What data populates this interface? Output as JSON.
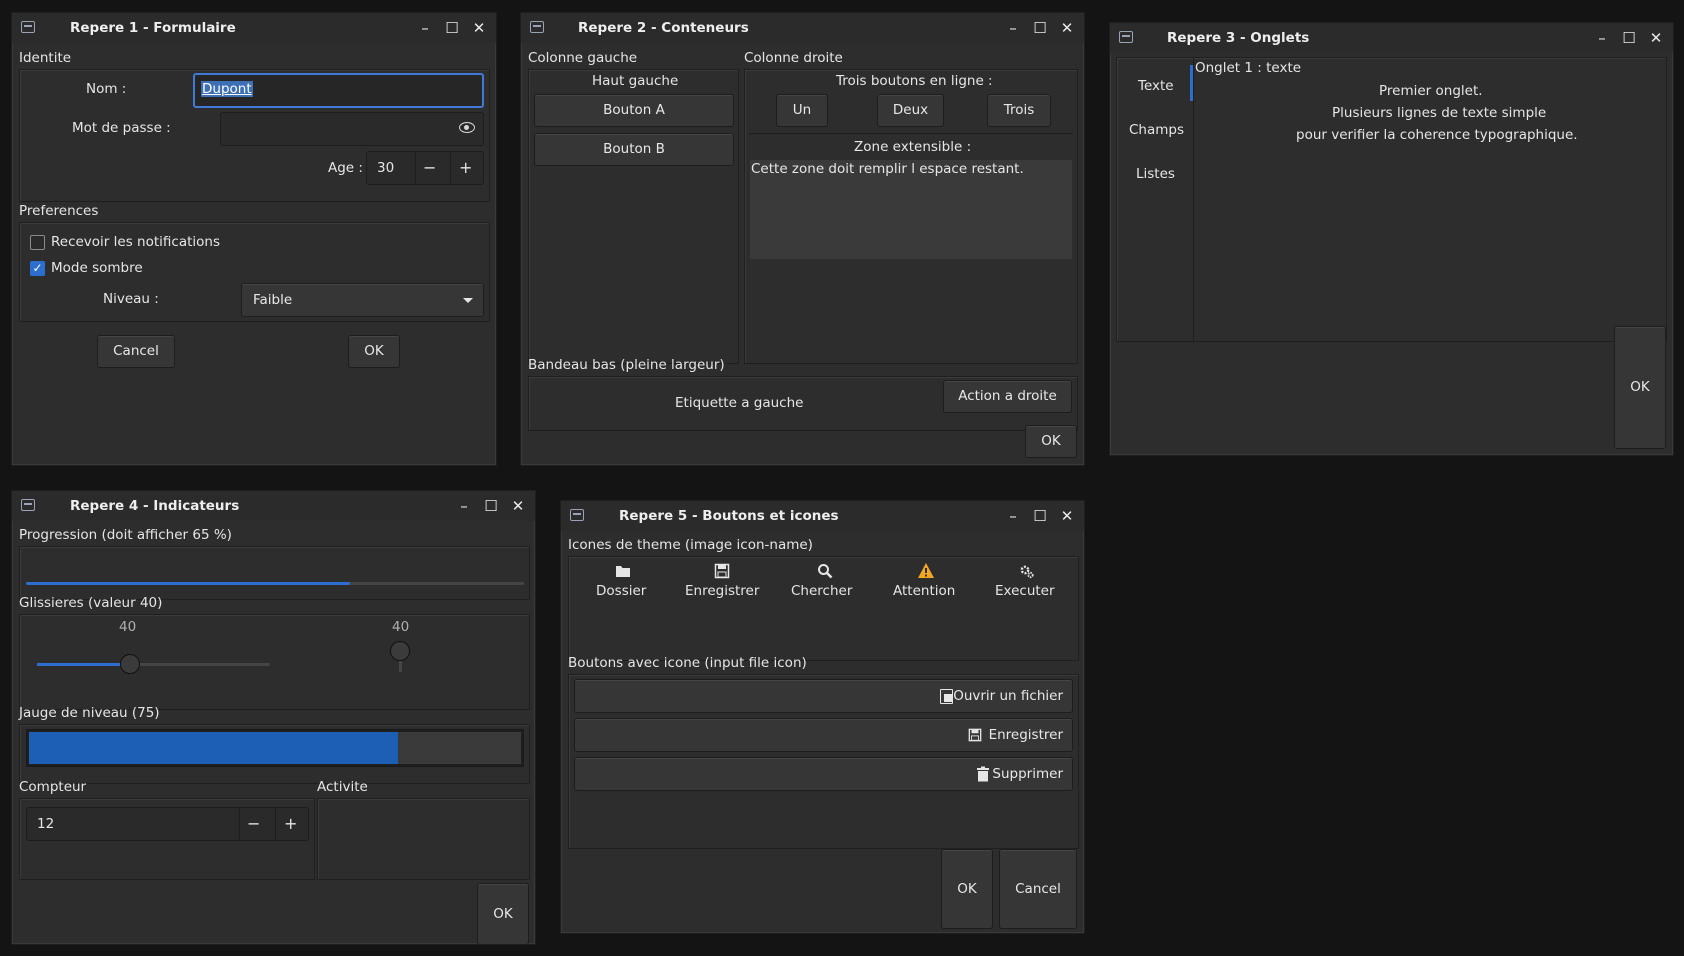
{
  "windows": {
    "w1": {
      "title": "Repere 1 - Formulaire",
      "identite": {
        "label": "Identite",
        "nom_label": "Nom :",
        "nom_value": "Dupont",
        "mdp_label": "Mot de passe :",
        "age_label": "Age :",
        "age_value": "30"
      },
      "preferences": {
        "label": "Preferences",
        "notif_label": "Recevoir les notifications",
        "notif_checked": false,
        "sombre_label": "Mode sombre",
        "sombre_checked": true,
        "niveau_label": "Niveau :",
        "niveau_value": "Faible"
      },
      "cancel_label": "Cancel",
      "ok_label": "OK"
    },
    "w2": {
      "title": "Repere 2 - Conteneurs",
      "left": {
        "label": "Colonne gauche",
        "heading": "Haut gauche",
        "btn_a": "Bouton A",
        "btn_b": "Bouton B"
      },
      "right": {
        "label": "Colonne droite",
        "heading": "Trois boutons en ligne :",
        "btn1": "Un",
        "btn2": "Deux",
        "btn3": "Trois",
        "zone_label": "Zone extensible :",
        "zone_text": "Cette zone doit remplir l espace restant."
      },
      "bottom": {
        "label": "Bandeau bas (pleine largeur)",
        "left_text": "Etiquette a gauche",
        "action": "Action a droite"
      },
      "ok_label": "OK"
    },
    "w3": {
      "title": "Repere 3 - Onglets",
      "tabs": [
        "Texte",
        "Champs",
        "Listes"
      ],
      "active_tab": "Texte",
      "page_label": "Onglet 1 : texte",
      "lines": [
        "Premier onglet.",
        "Plusieurs lignes de texte simple",
        "pour verifier la coherence typographique."
      ],
      "ok_label": "OK"
    },
    "w4": {
      "title": "Repere 4 - Indicateurs",
      "progress": {
        "label": "Progression (doit afficher 65 %)",
        "fraction": 0.65
      },
      "sliders": {
        "label": "Glissieres (valeur 40)",
        "h_value": "40",
        "v_value": "40",
        "h_fraction": 0.4,
        "v_fraction": 0.4
      },
      "gauge": {
        "label": "Jauge de niveau (75)",
        "value": 75,
        "max": 100
      },
      "compteur": {
        "label": "Compteur",
        "value": "12"
      },
      "activite": {
        "label": "Activite"
      },
      "ok_label": "OK"
    },
    "w5": {
      "title": "Repere 5 - Boutons et icones",
      "theme": {
        "label": "Icones de theme (image icon-name)",
        "items": [
          {
            "label": "Dossier",
            "icon": "folder-icon"
          },
          {
            "label": "Enregistrer",
            "icon": "save-icon"
          },
          {
            "label": "Chercher",
            "icon": "search-icon"
          },
          {
            "label": "Attention",
            "icon": "warning-icon",
            "color": "#f5a623"
          },
          {
            "label": "Executer",
            "icon": "gears-icon"
          }
        ]
      },
      "buttons": {
        "label": "Boutons avec icone (input file icon)",
        "open": "Ouvrir un fichier",
        "save": "Enregistrer",
        "delete": "Supprimer"
      },
      "ok_label": "OK",
      "cancel_label": "Cancel"
    }
  },
  "colors": {
    "accent": "#1c5fb5",
    "window_bg": "#2d2d2d",
    "desktop_bg": "#141414",
    "warning": "#f5a623"
  }
}
